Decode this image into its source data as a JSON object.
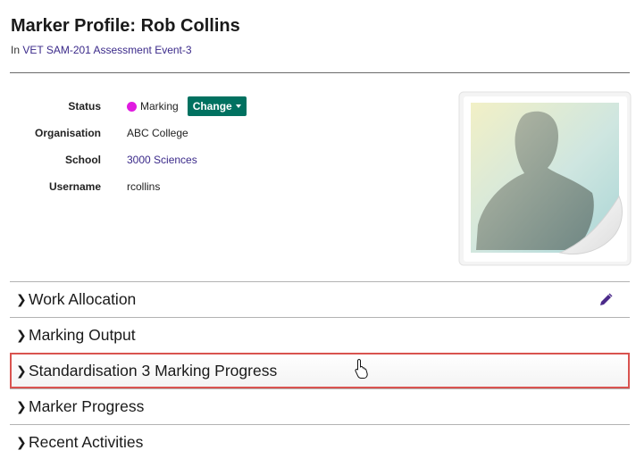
{
  "header": {
    "title": "Marker Profile: Rob Collins",
    "context_prefix": "In",
    "context_link": "VET SAM-201 Assessment Event-3"
  },
  "profile": {
    "status_label": "Status",
    "status_value": "Marking",
    "status_color": "#e01be0",
    "change_label": "Change",
    "organisation_label": "Organisation",
    "organisation_value": "ABC College",
    "school_label": "School",
    "school_value": "3000 Sciences",
    "username_label": "Username",
    "username_value": "rcollins"
  },
  "sections": [
    {
      "label": "Work Allocation"
    },
    {
      "label": "Marking Output"
    },
    {
      "label": "Standardisation 3 Marking Progress"
    },
    {
      "label": "Marker Progress"
    },
    {
      "label": "Recent Activities"
    }
  ],
  "icons": {
    "expand": "chevron-right-icon",
    "edit": "pencil-icon",
    "avatar": "default-avatar-silhouette",
    "cursor": "hand-pointer-icon"
  },
  "colors": {
    "accent": "#007160",
    "link": "#3b2a8a",
    "highlight_border": "#d9534f",
    "edit_icon": "#4b2a8a"
  }
}
